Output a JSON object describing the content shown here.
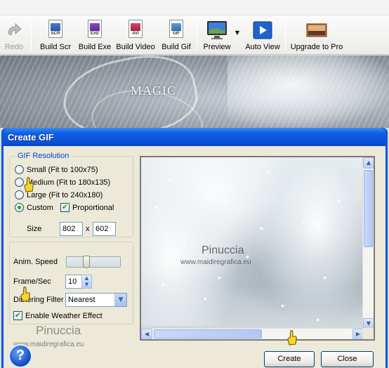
{
  "toolbar": {
    "items": [
      {
        "label": "Redo",
        "icon": "redo-icon",
        "enabled": false
      },
      {
        "label": "Build Scr",
        "icon": "scr-file-icon",
        "tag": "SCR"
      },
      {
        "label": "Build Exe",
        "icon": "exe-file-icon",
        "tag": "EXE"
      },
      {
        "label": "Build Video",
        "icon": "avi-file-icon",
        "tag": "AVI"
      },
      {
        "label": "Build Gif",
        "icon": "gif-file-icon",
        "tag": "GIF"
      },
      {
        "label": "Preview",
        "icon": "monitor-icon"
      },
      {
        "label": "Auto View",
        "icon": "play-icon"
      },
      {
        "label": "Upgrade to Pro",
        "icon": "upgrade-icon"
      }
    ]
  },
  "background": {
    "title": "MAGIC"
  },
  "dialog": {
    "title": "Create GIF",
    "resolution": {
      "legend": "GIF Resolution",
      "options": [
        {
          "label": "Small (Fit to 100x75)",
          "selected": false
        },
        {
          "label": "Medium (Fit to 180x135)",
          "selected": false
        },
        {
          "label": "Large (Fit to 240x180)",
          "selected": false
        },
        {
          "label": "Custom",
          "selected": true
        }
      ],
      "proportional_label": "Proportional",
      "proportional_checked": true,
      "size_label": "Size",
      "width": "802",
      "times": "x",
      "height": "602"
    },
    "settings": {
      "anim_speed_label": "Anim. Speed",
      "anim_speed_level": 0.35,
      "frame_sec_label": "Frame/Sec",
      "frame_sec_value": "10",
      "dithering_label": "Dithering Filter",
      "dithering_value": "Nearest",
      "weather_label": "Enable Weather Effect",
      "weather_checked": true
    },
    "preview": {
      "watermark_name": "Pinuccia",
      "watermark_url": "www.maidiregrafica.eu"
    },
    "buttons": {
      "create": "Create",
      "close": "Close"
    },
    "footer_watermark_name": "Pinuccia",
    "footer_watermark_url": "www.maidiregrafica.eu"
  },
  "colors": {
    "title_blue": "#0a55e0",
    "legend_blue": "#0046d5",
    "face": "#ece9d8",
    "check_green": "#21a121"
  }
}
